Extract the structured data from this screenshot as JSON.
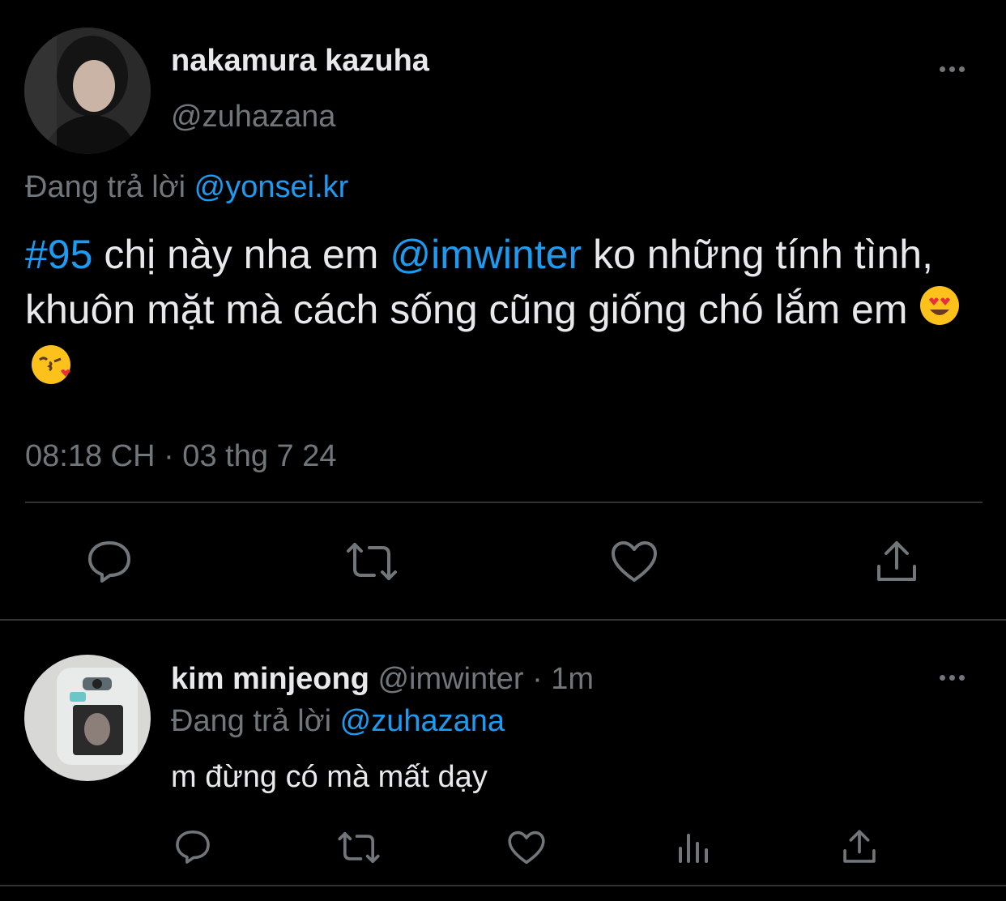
{
  "tweet": {
    "author_name": "nakamura kazuha",
    "author_handle": "@zuhazana",
    "replying_label": "Đang trả lời",
    "replying_to": "@yonsei.kr",
    "hashtag": "#95",
    "text_part1": " chị này nha em ",
    "mention": "@imwinter",
    "text_part2": " ko những tính tình, khuôn mặt mà cách sống cũng giống chó lắm em ",
    "emojis": [
      "heart-eyes-emoji",
      "kissing-heart-emoji"
    ],
    "timestamp": "08:18 CH · 03 thg 7 24"
  },
  "reply": {
    "author_name": "kim minjeong",
    "author_handle": "@imwinter",
    "time": " · 1m",
    "replying_label": "Đang trả lời",
    "replying_to": "@zuhazana",
    "text": "m đừng có mà mất dạy"
  },
  "colors": {
    "background": "#000000",
    "text": "#e7e9ea",
    "muted": "#71767b",
    "link": "#1d9bf0",
    "divider": "#2f3336"
  },
  "icons": {
    "main_actions": [
      "reply-icon",
      "retweet-icon",
      "like-icon",
      "share-icon"
    ],
    "reply_actions": [
      "reply-icon",
      "retweet-icon",
      "like-icon",
      "views-icon",
      "share-icon"
    ]
  }
}
